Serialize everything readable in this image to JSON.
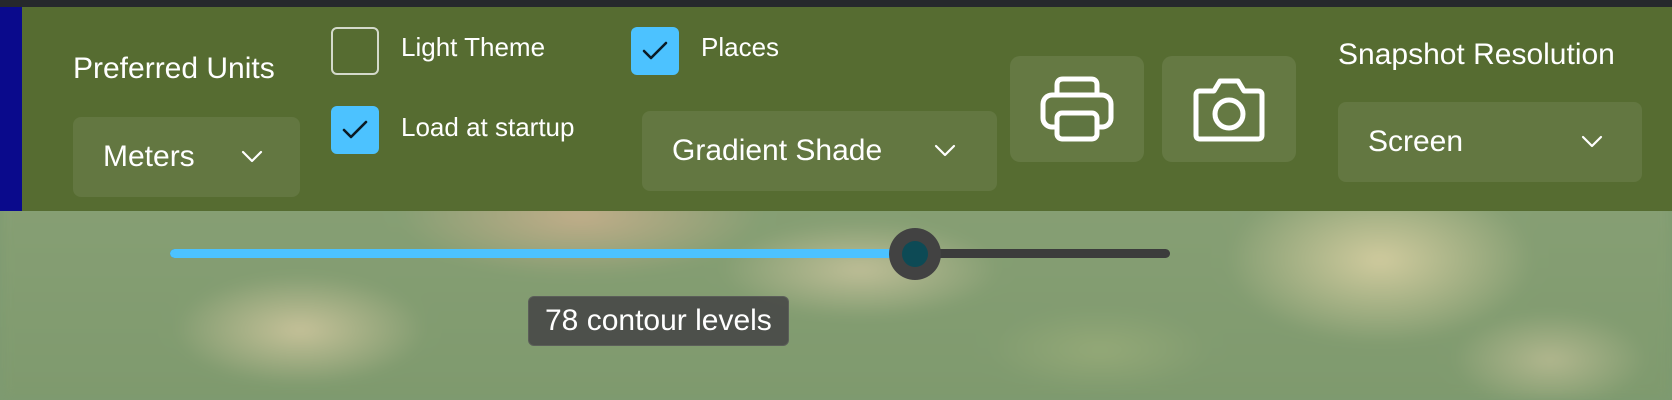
{
  "toolbar": {
    "preferred_units": {
      "label": "Preferred Units",
      "selected": "Meters"
    },
    "light_theme": {
      "label": "Light Theme",
      "checked": false
    },
    "load_at_startup": {
      "label": "Load at startup",
      "checked": true
    },
    "places": {
      "label": "Places",
      "checked": true
    },
    "shading": {
      "selected": "Gradient Shade"
    },
    "print_button": {
      "icon": "printer-icon"
    },
    "snapshot_button": {
      "icon": "camera-icon"
    },
    "snapshot_resolution": {
      "label": "Snapshot Resolution",
      "selected": "Screen"
    }
  },
  "contour_slider": {
    "value": 78,
    "fill_fraction": 0.745,
    "tooltip": "78 contour levels"
  },
  "colors": {
    "panel": "#566c31",
    "accent": "#4cc2ff",
    "left_strip": "#0a0a8c",
    "slider_track": "#3c3c3c"
  }
}
